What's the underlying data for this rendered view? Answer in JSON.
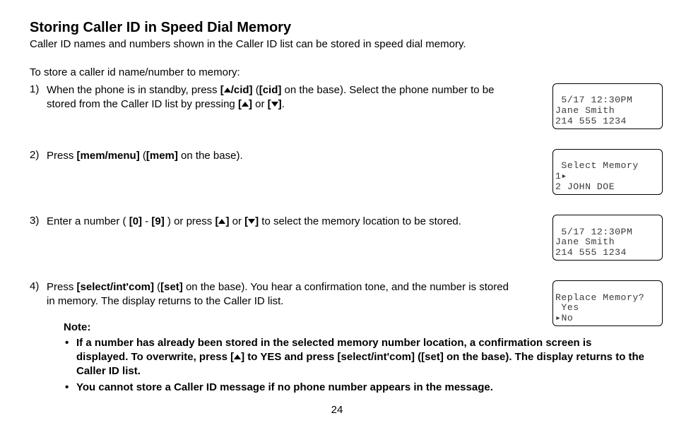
{
  "heading": "Storing Caller ID in Speed Dial Memory",
  "intro": "Caller ID names and numbers shown in the Caller ID list can be stored in speed dial memory.",
  "subintro": "To store a caller id name/number to memory:",
  "steps": [
    {
      "num": "1)",
      "pre": "When the phone is in standby, press ",
      "b1": "[",
      "b2": "/cid]",
      "mid1": " (",
      "b3": "[cid]",
      "mid2": " on the base). Select the phone number to be stored from the Caller ID list by pressing ",
      "b4": "[",
      "b5": "]",
      "or": " or ",
      "b6": "[",
      "b7": "]",
      "end": ".",
      "lcd": [
        " 5/17 12:30PM",
        "Jane Smith",
        "214 555 1234"
      ]
    },
    {
      "num": "2)",
      "pre": "Press ",
      "b1": "[mem/menu]",
      "mid1": " (",
      "b2": "[mem]",
      "end": " on the base).",
      "lcd": [
        " Select Memory",
        "1▸",
        "2 JOHN DOE"
      ]
    },
    {
      "num": "3)",
      "pre": "Enter a number ( ",
      "b1": "[0]",
      "dash": " - ",
      "b2": "[9]",
      "mid1": " ) or press ",
      "b3": "[",
      "b4": "]",
      "or": " or ",
      "b5": "[",
      "b6": "]",
      "end": " to select the memory location to be stored.",
      "lcd": [
        " 5/17 12:30PM",
        "Jane Smith",
        "214 555 1234"
      ]
    },
    {
      "num": "4)",
      "pre": "Press ",
      "b1": "[select/int'com]",
      "mid1": " (",
      "b2": "[set]",
      "end": " on the base). You hear a confirmation tone, and the number is stored in memory. The display returns to the Caller ID list.",
      "lcd": [
        "Replace Memory?",
        " Yes",
        "▸No"
      ]
    }
  ],
  "note_label": "Note:",
  "notes": {
    "n1_a": "If a number has already been stored in the selected memory number location, a confirmation screen is displayed. To overwrite, press [",
    "n1_b": "] to YES and press [select/int'com] ([set] on the base). The display returns to the Caller ID list.",
    "n2": "You cannot store a Caller ID message if no phone number appears in the message."
  },
  "pagenum": "24"
}
